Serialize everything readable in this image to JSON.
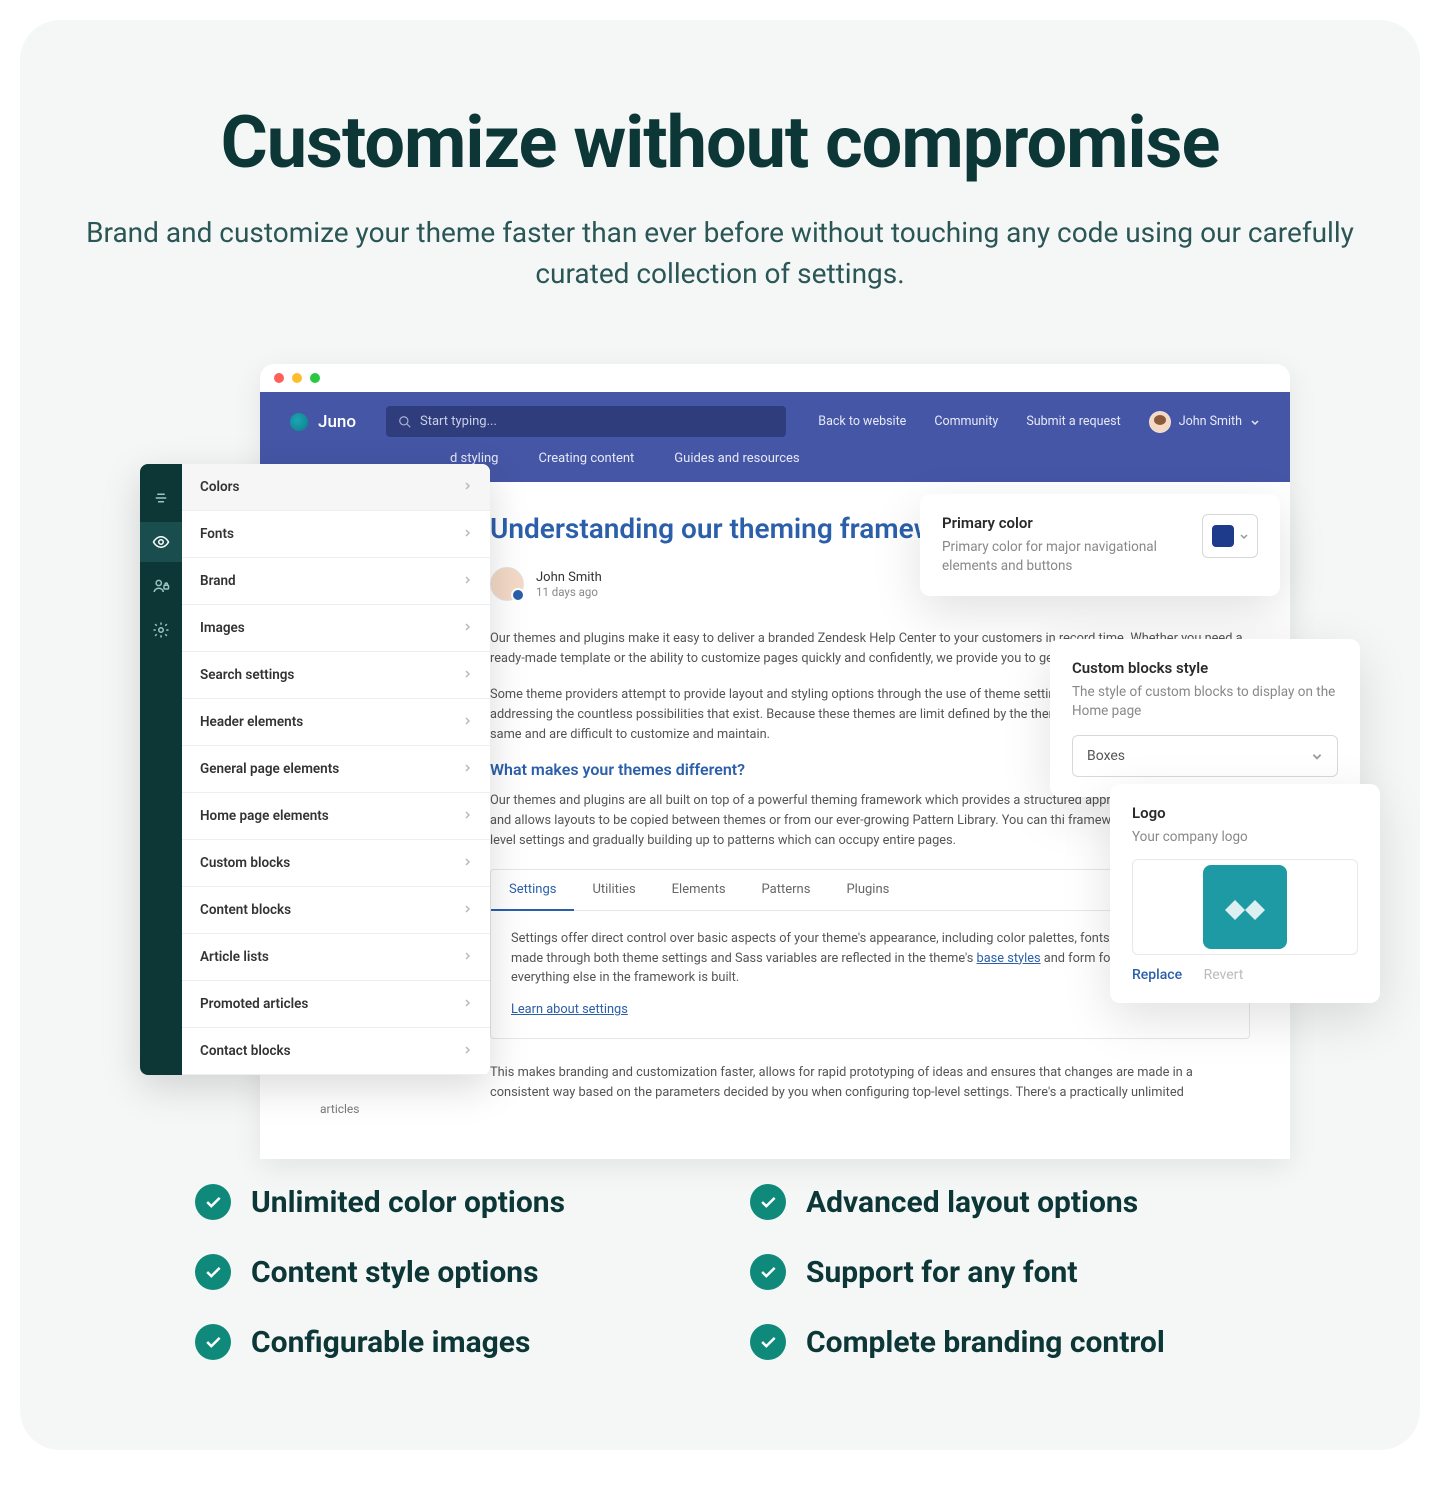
{
  "hero": {
    "title": "Customize without compromise",
    "subtitle": "Brand and customize your theme faster than ever before without touching any code using our carefully curated collection of settings."
  },
  "app": {
    "brand_name": "Juno",
    "search_placeholder": "Start typing...",
    "header_links": {
      "back": "Back to website",
      "community": "Community",
      "submit": "Submit a request"
    },
    "user_name": "John Smith",
    "nav_tabs": {
      "styling": "d styling",
      "creating": "Creating content",
      "guides": "Guides and resources"
    }
  },
  "editor_categories": [
    "Colors",
    "Fonts",
    "Brand",
    "Images",
    "Search settings",
    "Header elements",
    "General page elements",
    "Home page elements",
    "Custom blocks",
    "Content blocks",
    "Article lists",
    "Promoted articles",
    "Contact blocks"
  ],
  "article": {
    "title": "Understanding our theming framewor",
    "author": "John Smith",
    "date": "11 days ago",
    "p1": "Our themes and plugins make it easy to deliver a branded Zendesk Help Center to your customers in record time. Whether you need a ready-made template or the ability to customize pages quickly and confidently, we provide you                                    to get the job done.",
    "p2": "Some theme providers attempt to provide layout and styling options through the use of theme settings                                          doesn't come close to addressing the countless possibilities that exist. Because these themes are limit                                                  defined by the theme author they often look the same and are difficult to customize and maintain.",
    "h2": "What makes your themes different?",
    "p3": "Our themes and plugins are all built on top of a powerful theming framework which provides a structured approach to customization and allows layouts to be copied between themes or from our ever-growing Pattern Library. You can thi                              framework as starting with low-level settings and gradually building up to patterns which can occupy entire pages.",
    "tabs": {
      "t1": "Settings",
      "t2": "Utilities",
      "t3": "Elements",
      "t4": "Patterns",
      "t5": "Plugins"
    },
    "tab_body_a": "Settings offer direct control over basic aspects of your theme's appearance, including color palettes, fonts and in                        Changes made through both theme settings and Sass variables are reflected in the theme's ",
    "tab_body_link": "base styles",
    "tab_body_b": " and form                         foundation on which everything else in the framework is built.",
    "learn_link": "Learn about settings",
    "p4": "This makes branding and customization faster, allows for rapid prototyping of ideas and ensures that changes are made in a consistent way based on the parameters decided by you when configuring top-level settings. There's a practically unlimited",
    "sidebar_hint": "articles"
  },
  "floaters": {
    "primary": {
      "title": "Primary color",
      "desc": "Primary color for major navigational elements and buttons",
      "swatch": "#1e3a8a"
    },
    "custom": {
      "title": "Custom blocks style",
      "desc": "The style of custom blocks to display on the Home page",
      "value": "Boxes"
    },
    "logo": {
      "title": "Logo",
      "desc": "Your company logo",
      "replace": "Replace",
      "revert": "Revert"
    }
  },
  "features": [
    "Unlimited color options",
    "Advanced layout options",
    "Content style options",
    "Support for any font",
    "Configurable images",
    "Complete branding control"
  ]
}
